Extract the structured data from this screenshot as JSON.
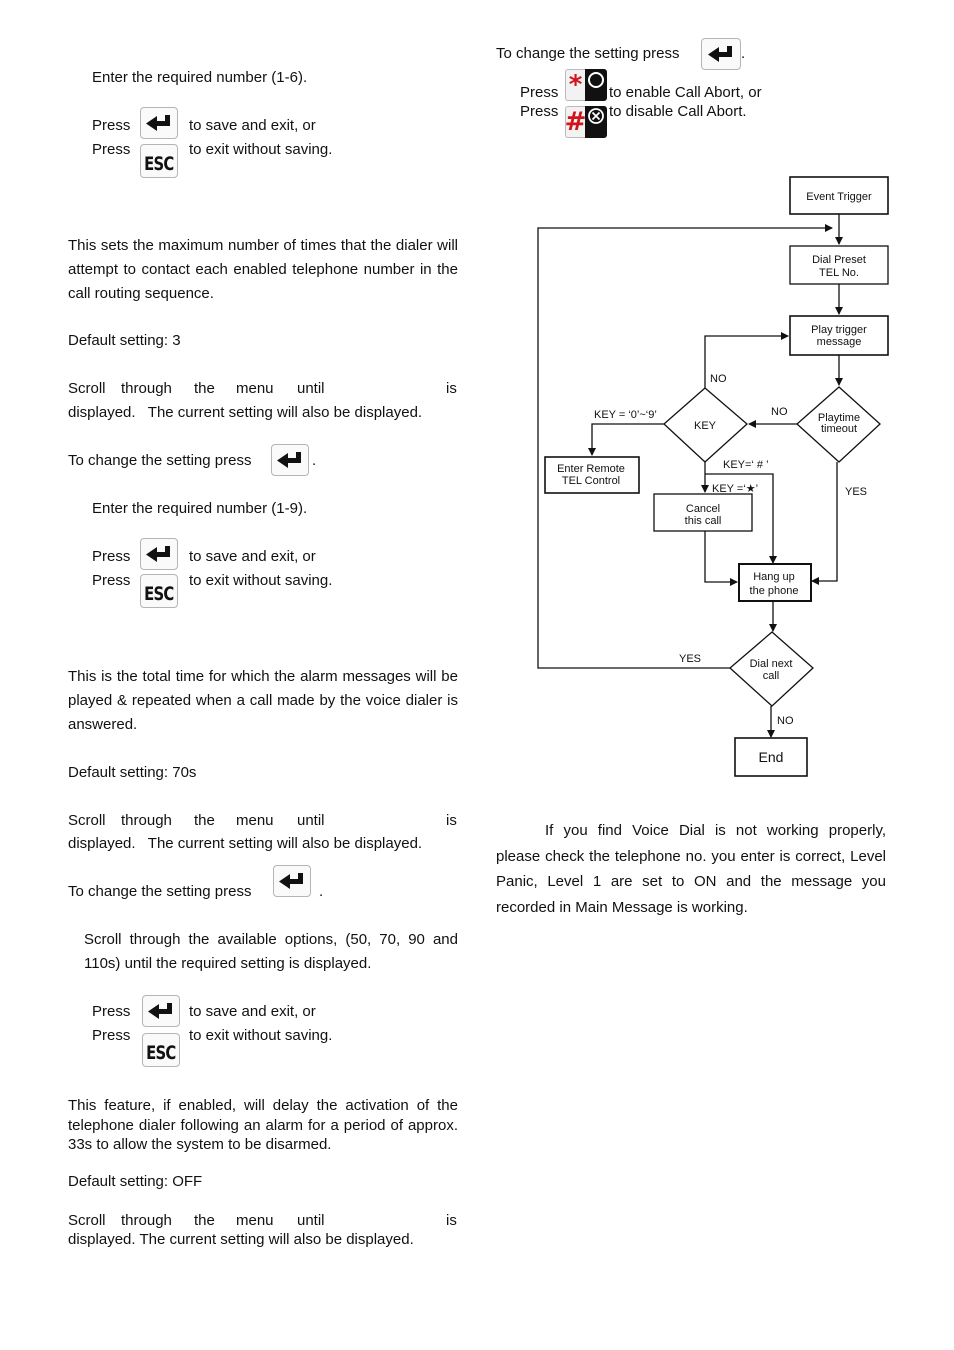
{
  "left_column": {
    "section1": {
      "enter_instruction": "Enter the required number (1-6).",
      "press_label_1": "Press",
      "save_text": "to save and exit, or",
      "press_label_2": "Press",
      "esc_text": "to exit without saving.",
      "esc_key_label": "ESC"
    },
    "section2": {
      "description": "This sets the maximum number of times that the dialer will attempt to contact each enabled telephone number in the call routing sequence.",
      "default_setting": "Default setting: 3",
      "scroll_words": [
        "Scroll",
        "through",
        "the",
        "menu",
        "until"
      ],
      "scroll_is": "is",
      "scroll_line2": "displayed.   The current setting will also be displayed.",
      "change_text": "To change the setting press",
      "change_period": ".",
      "enter_instruction": "Enter the required number (1-9).",
      "press_label_1": "Press",
      "save_text": "to save and exit, or",
      "press_label_2": "Press",
      "esc_text": "to exit without saving.",
      "esc_key_label": "ESC"
    },
    "section3": {
      "description": "This is the total time for which the alarm messages will be played & repeated when a call made by the voice dialer is answered.",
      "default_setting": "Default setting: 70s",
      "scroll_words": [
        "Scroll",
        "through",
        "the",
        "menu",
        "until"
      ],
      "scroll_is": "is",
      "scroll_line2": "displayed.   The current setting will also be displayed.",
      "change_text": "To change the setting press",
      "change_period": ".",
      "options_text": "Scroll through the available options, (50, 70, 90 and 110s) until the required setting is displayed.",
      "press_label_1": "Press",
      "save_text": "to save and exit, or",
      "press_label_2": "Press",
      "esc_text": "to exit without saving.",
      "esc_key_label": "ESC"
    },
    "section4": {
      "description": "This feature, if enabled, will delay the activation of the telephone dialer following an alarm for a period of approx. 33s to allow the system to be disarmed.",
      "default_setting": "Default setting: OFF",
      "scroll_words": [
        "Scroll",
        "through",
        "the",
        "menu",
        "until"
      ],
      "scroll_is": "is",
      "scroll_line2": "displayed. The current setting will also be displayed."
    }
  },
  "right_column": {
    "call_abort": {
      "change_text": "To change the setting press",
      "change_period": ".",
      "press_label_1": "Press",
      "enable_text": "to enable Call Abort, or",
      "press_label_2": "Press",
      "disable_text": "to disable Call Abort.",
      "star_symbol": "*",
      "hash_symbol": "#"
    },
    "flowchart": {
      "nodes": {
        "event_trigger": "Event Trigger",
        "dial_preset": [
          "Dial Preset",
          "TEL No."
        ],
        "play_trigger": [
          "Play trigger",
          "message"
        ],
        "playtime_timeout": [
          "Playtime",
          "timeout"
        ],
        "key": "KEY",
        "enter_remote": [
          "Enter Remote",
          "TEL Control"
        ],
        "cancel_call": [
          "Cancel",
          "this call"
        ],
        "hang_up": [
          "Hang up",
          "the phone"
        ],
        "dial_next": [
          "Dial next",
          "call"
        ],
        "end": "End"
      },
      "labels": {
        "no_key_top": "NO",
        "no_timeout": "NO",
        "key_digits": "KEY = ‘0’~‘9’",
        "key_hash": "KEY=‘ # ’",
        "key_star": "KEY =‘★’",
        "yes_timeout": "YES",
        "yes_dial_next": "YES",
        "no_dial_next": "NO"
      }
    },
    "troubleshoot": {
      "text": "If you find Voice Dial is not working properly, please check the telephone no. you enter is correct, Level Panic, Level 1 are set to ON and the message you recorded in Main Message is working."
    }
  },
  "colors": {
    "text": "#111111",
    "key_border": "#b5b5b5",
    "star_hash_red": "#d0141c",
    "key_dark": "#111111"
  }
}
